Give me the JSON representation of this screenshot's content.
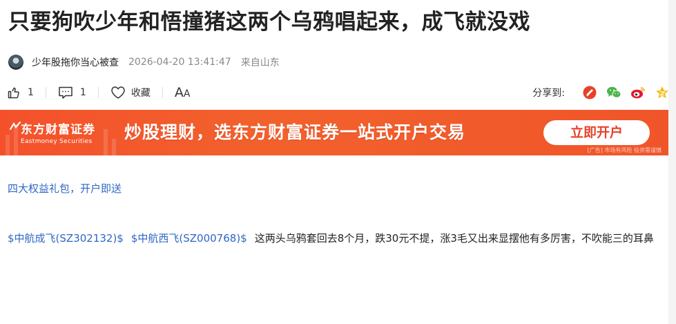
{
  "article": {
    "title": "只要狗吹少年和悟撞猪这两个乌鸦唱起来，成飞就没戏",
    "author": "少年股拖你当心被查",
    "timestamp": "2026-04-20 13:41:47",
    "location": "来自山东"
  },
  "actions": {
    "like_icon": "thumbs-up-icon",
    "like_count": "1",
    "comment_icon": "comment-icon",
    "comment_count": "1",
    "favorite_icon": "heart-icon",
    "favorite_label": "收藏",
    "font_big": "A",
    "font_small": "A"
  },
  "share": {
    "label": "分享到:",
    "targets": [
      {
        "name": "share-app-icon",
        "color": "#e8412a"
      },
      {
        "name": "wechat-icon",
        "color": "#4bb34b"
      },
      {
        "name": "weibo-icon",
        "color": "#e6162d"
      },
      {
        "name": "qzone-icon",
        "color": "#f5b800"
      }
    ]
  },
  "banner": {
    "brand_cn": "东方财富证券",
    "brand_en": "Eastmoney Securities",
    "slogan": "炒股理财，选东方财富证券一站式开户交易",
    "cta": "立即开户",
    "ad_note": "[广告] 市场有风险 投资需谨慎",
    "color": "#f4512b"
  },
  "body": {
    "promo_link": "四大权益礼包，开户即送",
    "stocks": [
      "$中航成飞(SZ302132)$",
      "$中航西飞(SZ000768)$"
    ],
    "text": "这两头乌鸦套回去8个月，跌30元不提，涨3毛又出来显摆他有多厉害，不吹能三的耳鼻"
  }
}
